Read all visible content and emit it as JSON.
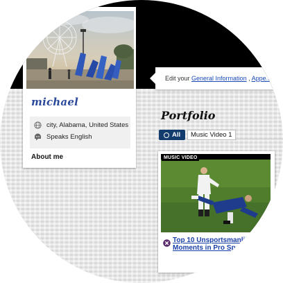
{
  "profile": {
    "name": "michael",
    "location": "city, Alabama, United States",
    "language": "Speaks English",
    "about_heading": "About me"
  },
  "edit_bar": {
    "prefix": "Edit your ",
    "link1": "General Information",
    "separator": " , ",
    "link2": "Appe..."
  },
  "portfolio": {
    "title": "Portfolio",
    "filters": {
      "all": "All",
      "music_video": "Music Video 1"
    }
  },
  "video": {
    "tag": "MUSIC VIDEO",
    "title_line1": "Top 10 Unsportsmanlik",
    "title_line2": "Moments in Pro Spo..."
  },
  "colors": {
    "name_blue": "#2c4a9c",
    "link_blue": "#1a49b8",
    "chip_navy": "#123c6e"
  },
  "icons": {
    "location": "globe-icon",
    "language": "speech-icon",
    "video_close": "close-icon"
  }
}
